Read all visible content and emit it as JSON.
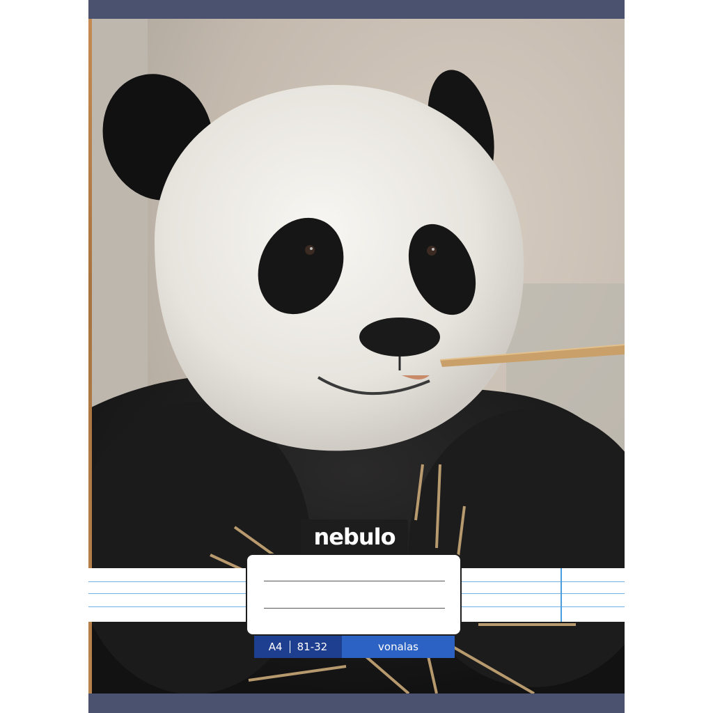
{
  "cover": {
    "brand": "nebulo",
    "format": "A4",
    "code": "81-32",
    "ruling": "vonalas"
  },
  "colors": {
    "band": "#4b5270",
    "ruled_line": "#6fb0e6",
    "info_left": "#1e3f8f",
    "info_right": "#2c62c4"
  },
  "photo_subject": "panda-eating-bamboo"
}
